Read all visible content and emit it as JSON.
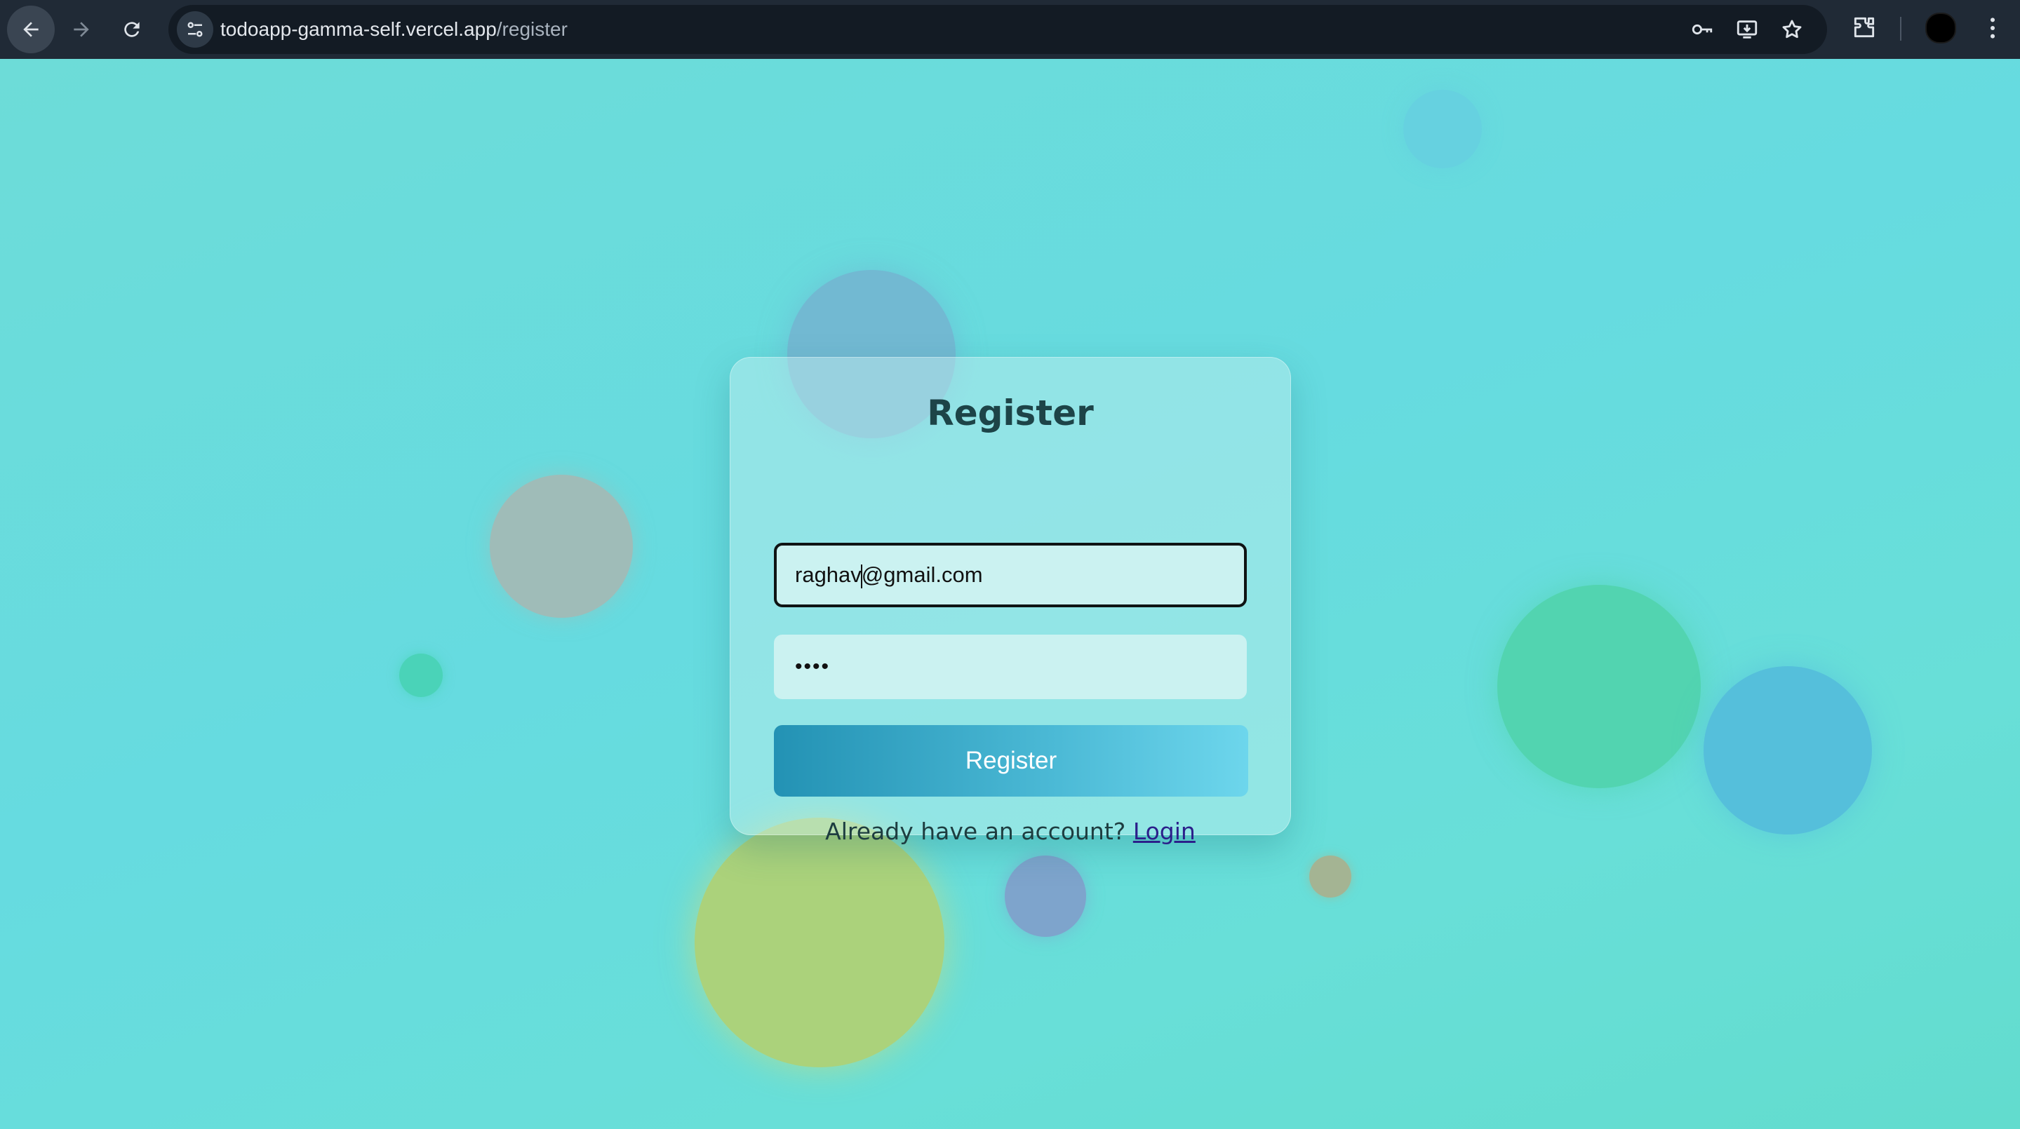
{
  "browser": {
    "url_host": "todoapp-gamma-self.vercel.app",
    "url_path": "/register",
    "icons": [
      "back-arrow-icon",
      "forward-arrow-icon",
      "reload-icon",
      "site-settings-icon",
      "password-key-icon",
      "install-app-icon",
      "bookmark-star-icon",
      "extensions-icon",
      "profile-avatar",
      "more-menu-icon"
    ]
  },
  "form": {
    "title": "Register",
    "email_value_before_caret": "raghav",
    "email_value_after_caret": "@gmail.com",
    "password_value": "••••",
    "submit_label": "Register",
    "login_prompt": "Already have an account?",
    "login_link": "Login"
  },
  "colors": {
    "background": "#66dbe0",
    "button_start": "#2392b4",
    "button_end": "#6dd6ec",
    "title": "#1d4448",
    "link": "#2b1f8a"
  }
}
